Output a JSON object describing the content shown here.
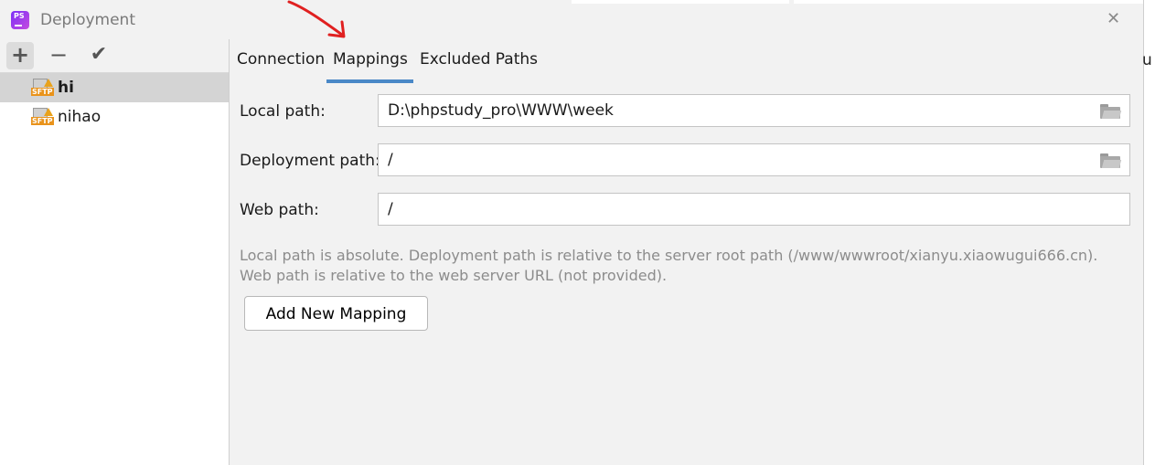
{
  "window": {
    "title": "Deployment",
    "app_icon_text": "PS",
    "close_glyph": "✕",
    "edge_text": "u"
  },
  "toolbar": {
    "add_glyph": "+",
    "remove_glyph": "−",
    "apply_glyph": "✔"
  },
  "servers": [
    {
      "name": "hi",
      "icon": "sftp-warning-icon",
      "icon_label": "SFTP",
      "selected": true
    },
    {
      "name": "nihao",
      "icon": "sftp-warning-icon",
      "icon_label": "SFTP",
      "selected": false
    }
  ],
  "tabs": [
    {
      "label": "Connection",
      "active": false
    },
    {
      "label": "Mappings",
      "active": true
    },
    {
      "label": "Excluded Paths",
      "active": false
    }
  ],
  "form": {
    "local_path": {
      "label": "Local path:",
      "value": "D:\\phpstudy_pro\\WWW\\week"
    },
    "deployment_path": {
      "label": "Deployment path:",
      "value": "/"
    },
    "web_path": {
      "label": "Web path:",
      "value": "/"
    }
  },
  "hints": {
    "line1": "Local path is absolute. Deployment path is relative to the server root path (/www/wwwroot/xianyu.xiaowugui666.cn).",
    "line2": "Web path is relative to the web server URL (not provided)."
  },
  "add_mapping_label": "Add New Mapping",
  "colors": {
    "accent": "#4a88c7",
    "annotation": "#e02020",
    "sftp_badge": "#e9931b"
  }
}
